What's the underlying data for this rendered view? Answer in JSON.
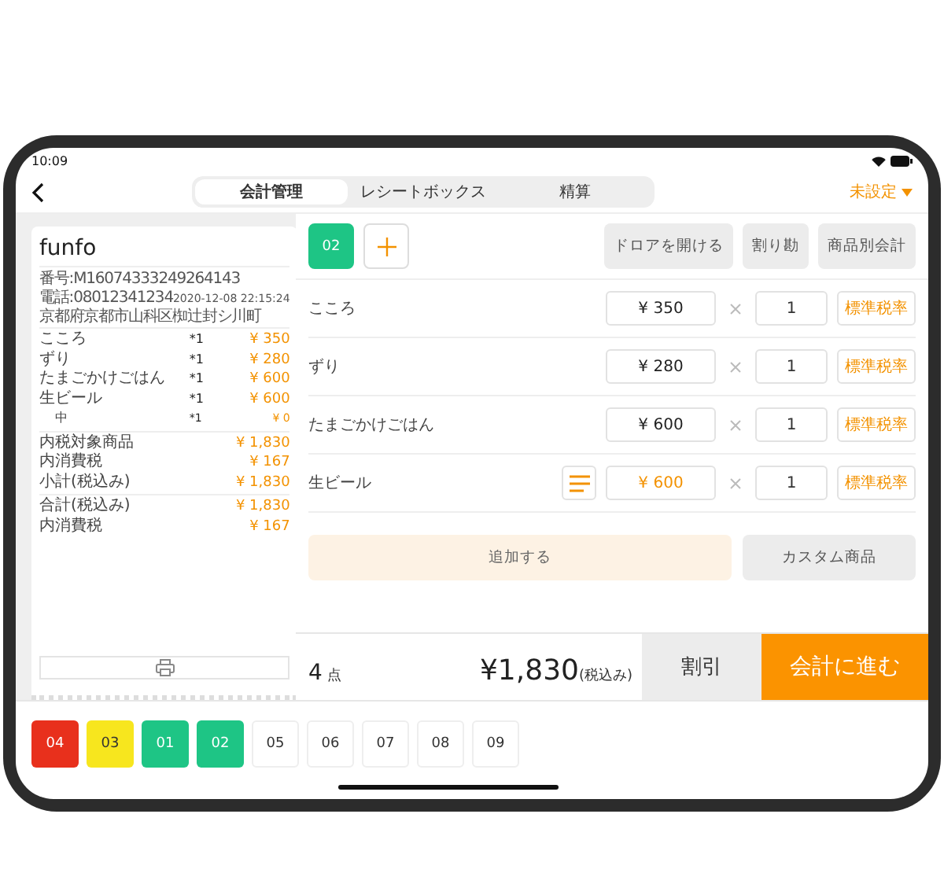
{
  "status_bar": {
    "time": "10:09"
  },
  "nav": {
    "tabs": [
      {
        "label": "会計管理",
        "selected": true
      },
      {
        "label": "レシートボックス",
        "selected": false
      },
      {
        "label": "精算",
        "selected": false
      }
    ],
    "setting": "未設定"
  },
  "receipt": {
    "shop": "funfo",
    "number": "番号:M16074333249264143",
    "phone": "電話:08012341234",
    "datetime": "2020-12-08 22:15:24",
    "address": "京都府京都市山科区椥辻封シ川町",
    "items": [
      {
        "kind": "item",
        "name": "こころ",
        "qty": "*1",
        "price": "¥ 350"
      },
      {
        "kind": "item",
        "name": "ずり",
        "qty": "*1",
        "price": "¥ 280"
      },
      {
        "kind": "item",
        "name": "たまごかけごはん",
        "qty": "*1",
        "price": "¥ 600"
      },
      {
        "kind": "item",
        "name": "生ビール",
        "qty": "*1",
        "price": "¥ 600"
      },
      {
        "kind": "option",
        "name": "中",
        "qty": "*1",
        "price": "¥ 0"
      }
    ],
    "summary_groups": [
      [
        {
          "label": "内税対象商品",
          "value": "¥ 1,830"
        },
        {
          "label": "内消費税",
          "value": "¥ 167"
        },
        {
          "label": "小計(税込み)",
          "value": "¥ 1,830"
        }
      ],
      [
        {
          "label": "合計(税込み)",
          "value": "¥ 1,830"
        },
        {
          "label": "内消費税",
          "value": "¥ 167"
        }
      ]
    ]
  },
  "order_tabs": [
    {
      "label": "02",
      "selected": true
    }
  ],
  "actions": [
    "ドロアを開ける",
    "割り勘",
    "商品別会計"
  ],
  "order_items": [
    {
      "name": "こころ",
      "has_options": false,
      "price": "¥ 350",
      "qty": "1",
      "tax": "標準税率"
    },
    {
      "name": "ずり",
      "has_options": false,
      "price": "¥ 280",
      "qty": "1",
      "tax": "標準税率"
    },
    {
      "name": "たまごかけごはん",
      "has_options": false,
      "price": "¥ 600",
      "qty": "1",
      "tax": "標準税率"
    },
    {
      "name": "生ビール",
      "has_options": true,
      "price": "¥ 600",
      "qty": "1",
      "tax": "標準税率"
    }
  ],
  "add_button": "追加する",
  "custom_button": "カスタム商品",
  "footer": {
    "count": "4",
    "count_unit": "点",
    "total": "¥1,830",
    "total_suffix": "(税込み)",
    "discount": "割引",
    "checkout": "会計に進む"
  },
  "tickets": [
    {
      "label": "04",
      "color": "#e8301c"
    },
    {
      "label": "03",
      "color": "#f7e61e"
    },
    {
      "label": "01",
      "color": "#1ec585"
    },
    {
      "label": "02",
      "color": "#1ec585"
    },
    {
      "label": "05",
      "color": "#ffffff"
    },
    {
      "label": "06",
      "color": "#ffffff"
    },
    {
      "label": "07",
      "color": "#ffffff"
    },
    {
      "label": "08",
      "color": "#ffffff"
    },
    {
      "label": "09",
      "color": "#ffffff"
    }
  ]
}
